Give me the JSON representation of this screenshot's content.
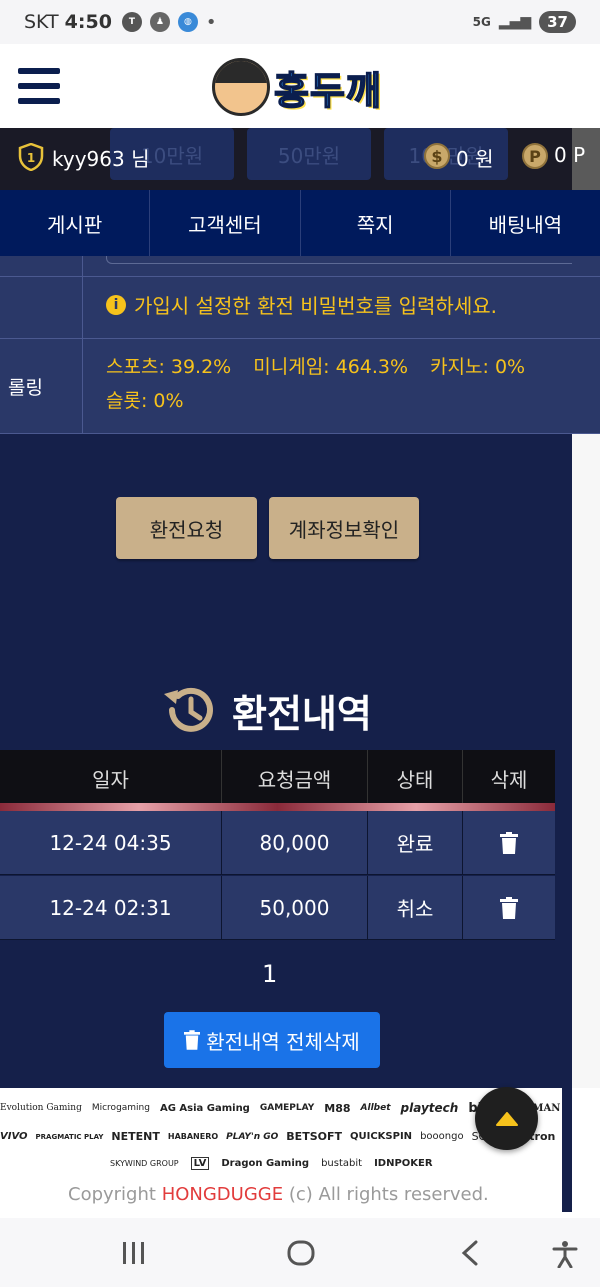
{
  "status": {
    "carrier": "SKT",
    "time": "4:50",
    "network": "5G",
    "battery": "37"
  },
  "header": {
    "logo_text": "홍두깨"
  },
  "ghost_buttons": [
    "10만원",
    "50만원",
    "100만원"
  ],
  "user": {
    "name": "kyy963 님",
    "money": "0 원",
    "points": "0 P"
  },
  "nav": [
    {
      "label": "게시판"
    },
    {
      "label": "고객센터"
    },
    {
      "label": "쪽지"
    },
    {
      "label": "배팅내역"
    }
  ],
  "form": {
    "notice": "가입시 설정한 환전 비밀번호를 입력하세요.",
    "rolling_label": "롤링",
    "rolling_items": [
      "스포츠: 39.2%",
      "미니게임: 464.3%",
      "카지노: 0%",
      "슬롯: 0%"
    ]
  },
  "actions": {
    "request_label": "환전요청",
    "account_label": "계좌정보확인"
  },
  "history": {
    "title": "환전내역",
    "columns": [
      "일자",
      "요청금액",
      "상태",
      "삭제"
    ],
    "rows": [
      {
        "date": "12-24 04:35",
        "amount": "80,000",
        "status": "완료"
      },
      {
        "date": "12-24 02:31",
        "amount": "50,000",
        "status": "취소"
      }
    ],
    "page": "1",
    "delete_all_label": "환전내역 전체삭제"
  },
  "footer": {
    "providers_row1": [
      "Evolution Gaming",
      "Microgaming",
      "AG Asia Gaming",
      "GAMEPLAY",
      "M88",
      "Allbet",
      "playtech",
      "bbin",
      "",
      "MAN"
    ],
    "providers_row2": [
      "VIVO",
      "PRAGMATIC PLAY",
      "NETENT",
      "HABANERO",
      "PLAY'n GO",
      "BETSOFT",
      "QUICKSPIN",
      "booongo",
      "SOFTBET",
      "tron"
    ],
    "providers_row3": [
      "SKYWIND GROUP",
      "LV",
      "Dragon Gaming",
      "bustabit",
      "IDNPOKER"
    ],
    "copyright_prefix": "Copyright",
    "copyright_brand": "HONGDUGGE",
    "copyright_suffix": "(c) All rights reserved."
  },
  "colors": {
    "dark_bg": "#15204a",
    "nav_bg": "#001a5c",
    "accent_yellow": "#f6c21c",
    "beige_button": "#c9b08a",
    "blue_button": "#1a73e8"
  }
}
